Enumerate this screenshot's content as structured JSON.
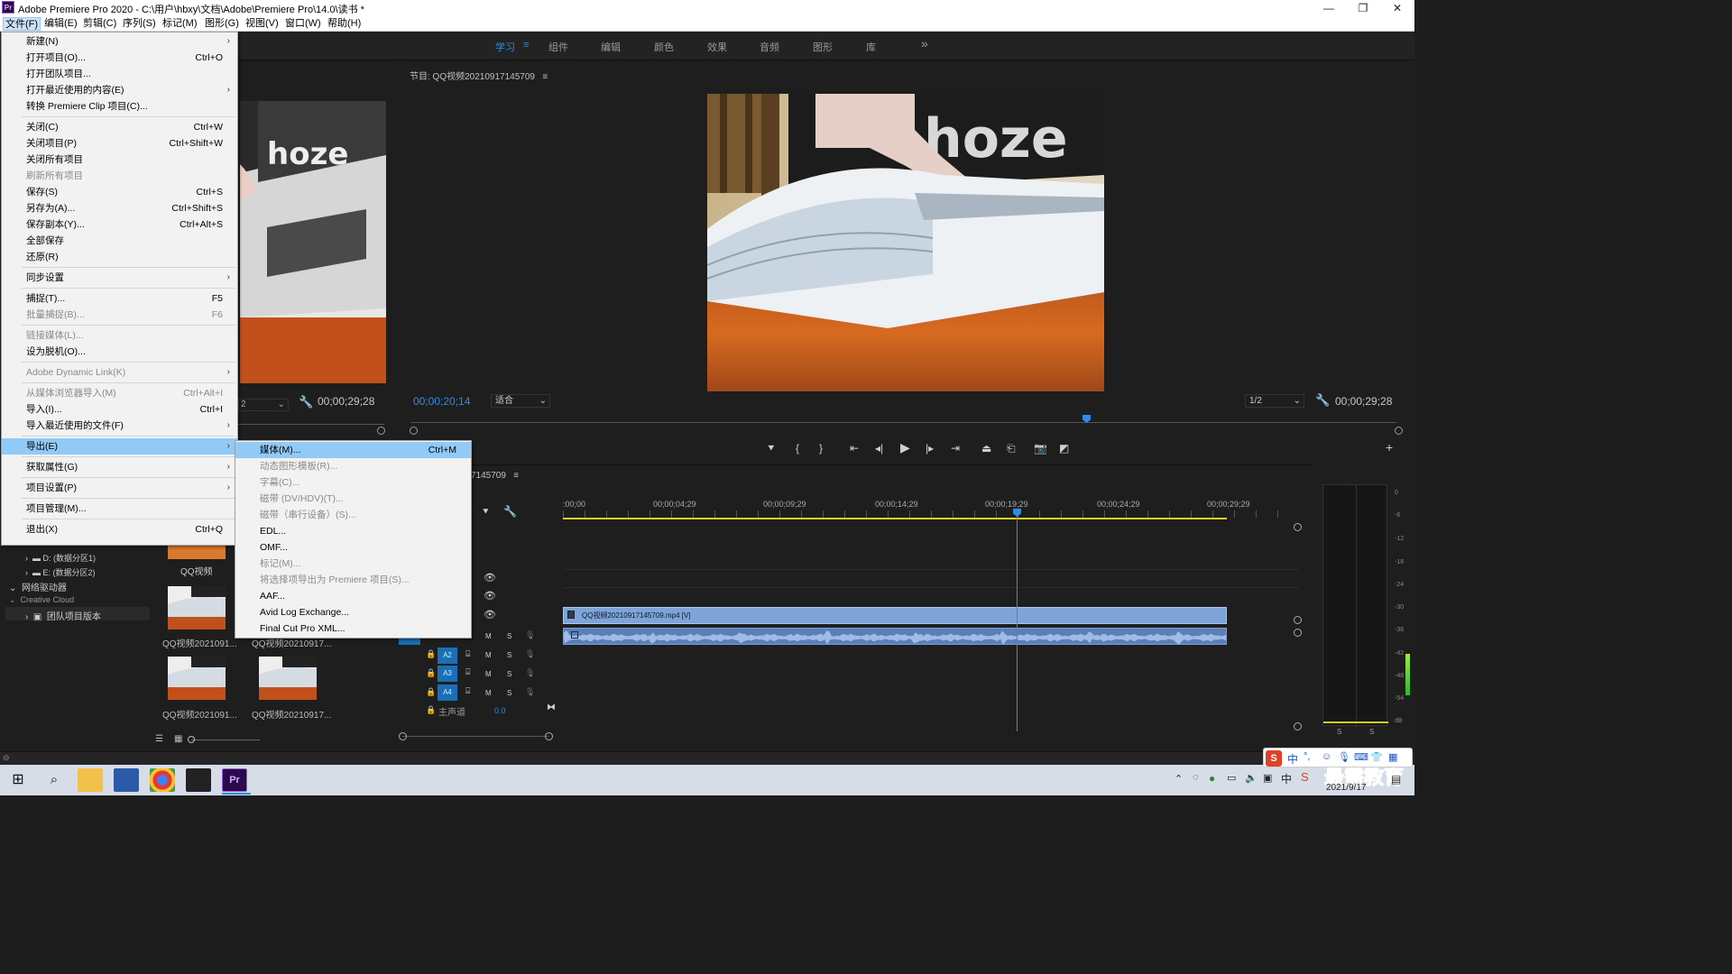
{
  "window": {
    "title": "Adobe Premiere Pro 2020 - C:\\用户\\hbxy\\文档\\Adobe\\Premiere Pro\\14.0\\读书 *",
    "logo_text": "Pr",
    "minimize_icon": "—",
    "maximize_icon": "❐",
    "close_icon": "✕"
  },
  "menubar": [
    {
      "label": "文件(F)"
    },
    {
      "label": "编辑(E)"
    },
    {
      "label": "剪辑(C)"
    },
    {
      "label": "序列(S)"
    },
    {
      "label": "标记(M)"
    },
    {
      "label": "图形(G)"
    },
    {
      "label": "视图(V)"
    },
    {
      "label": "窗口(W)"
    },
    {
      "label": "帮助(H)"
    }
  ],
  "workspaces": [
    {
      "label": "学习"
    },
    {
      "label": "≡"
    },
    {
      "label": "组件"
    },
    {
      "label": "编辑"
    },
    {
      "label": "颜色"
    },
    {
      "label": "效果"
    },
    {
      "label": "音频"
    },
    {
      "label": "图形"
    },
    {
      "label": "库"
    },
    {
      "label": "»"
    }
  ],
  "file_menu": [
    {
      "label": "新建(N)",
      "shortcut": "",
      "submenu": true,
      "disabled": false
    },
    {
      "label": "打开项目(O)...",
      "shortcut": "Ctrl+O",
      "submenu": false,
      "disabled": false
    },
    {
      "label": "打开团队项目...",
      "shortcut": "",
      "submenu": false,
      "disabled": false
    },
    {
      "label": "打开最近使用的内容(E)",
      "shortcut": "",
      "submenu": true,
      "disabled": false
    },
    {
      "label": "转换 Premiere Clip 项目(C)...",
      "shortcut": "",
      "submenu": false,
      "disabled": false
    },
    {
      "label": "关闭(C)",
      "shortcut": "Ctrl+W",
      "submenu": false,
      "disabled": false
    },
    {
      "label": "关闭项目(P)",
      "shortcut": "Ctrl+Shift+W",
      "submenu": false,
      "disabled": false
    },
    {
      "label": "关闭所有项目",
      "shortcut": "",
      "submenu": false,
      "disabled": false
    },
    {
      "label": "刷新所有项目",
      "shortcut": "",
      "submenu": false,
      "disabled": true
    },
    {
      "label": "保存(S)",
      "shortcut": "Ctrl+S",
      "submenu": false,
      "disabled": false
    },
    {
      "label": "另存为(A)...",
      "shortcut": "Ctrl+Shift+S",
      "submenu": false,
      "disabled": false
    },
    {
      "label": "保存副本(Y)...",
      "shortcut": "Ctrl+Alt+S",
      "submenu": false,
      "disabled": false
    },
    {
      "label": "全部保存",
      "shortcut": "",
      "submenu": false,
      "disabled": false
    },
    {
      "label": "还原(R)",
      "shortcut": "",
      "submenu": false,
      "disabled": false
    },
    {
      "label": "同步设置",
      "shortcut": "",
      "submenu": true,
      "disabled": false
    },
    {
      "label": "捕捉(T)...",
      "shortcut": "F5",
      "submenu": false,
      "disabled": false
    },
    {
      "label": "批量捕捉(B)...",
      "shortcut": "F6",
      "submenu": false,
      "disabled": true
    },
    {
      "label": "链接媒体(L)...",
      "shortcut": "",
      "submenu": false,
      "disabled": true
    },
    {
      "label": "设为脱机(O)...",
      "shortcut": "",
      "submenu": false,
      "disabled": false
    },
    {
      "label": "Adobe Dynamic Link(K)",
      "shortcut": "",
      "submenu": true,
      "disabled": true
    },
    {
      "label": "从媒体浏览器导入(M)",
      "shortcut": "Ctrl+Alt+I",
      "submenu": false,
      "disabled": true
    },
    {
      "label": "导入(I)...",
      "shortcut": "Ctrl+I",
      "submenu": false,
      "disabled": false
    },
    {
      "label": "导入最近使用的文件(F)",
      "shortcut": "",
      "submenu": true,
      "disabled": false
    },
    {
      "label": "导出(E)",
      "shortcut": "",
      "submenu": true,
      "disabled": false,
      "highlighted": true
    },
    {
      "label": "获取属性(G)",
      "shortcut": "",
      "submenu": true,
      "disabled": false
    },
    {
      "label": "项目设置(P)",
      "shortcut": "",
      "submenu": true,
      "disabled": false
    },
    {
      "label": "项目管理(M)...",
      "shortcut": "",
      "submenu": false,
      "disabled": false
    },
    {
      "label": "退出(X)",
      "shortcut": "Ctrl+Q",
      "submenu": false,
      "disabled": false
    }
  ],
  "export_submenu": [
    {
      "label": "媒体(M)...",
      "shortcut": "Ctrl+M",
      "disabled": false,
      "highlighted": true
    },
    {
      "label": "动态图形模板(R)...",
      "shortcut": "",
      "disabled": true
    },
    {
      "label": "字幕(C)...",
      "shortcut": "",
      "disabled": true
    },
    {
      "label": "磁带 (DV/HDV)(T)...",
      "shortcut": "",
      "disabled": true
    },
    {
      "label": "磁带（串行设备）(S)...",
      "shortcut": "",
      "disabled": true
    },
    {
      "label": "EDL...",
      "shortcut": "",
      "disabled": false
    },
    {
      "label": "OMF...",
      "shortcut": "",
      "disabled": false
    },
    {
      "label": "标记(M)...",
      "shortcut": "",
      "disabled": true
    },
    {
      "label": "将选择项导出为 Premiere 项目(S)...",
      "shortcut": "",
      "disabled": true
    },
    {
      "label": "AAF...",
      "shortcut": "",
      "disabled": false
    },
    {
      "label": "Avid Log Exchange...",
      "shortcut": "",
      "disabled": false
    },
    {
      "label": "Final Cut Pro XML...",
      "shortcut": "",
      "disabled": false
    }
  ],
  "program_monitor": {
    "title": "节目: QQ视频20210917145709",
    "menu_icon": "≡",
    "current_timecode": "00;00;20;14",
    "fit_label": "适合",
    "resolution": "1/2",
    "duration": "00;00;29;28"
  },
  "source_monitor": {
    "duration": "00;00;29;28",
    "fraction_fragment": "2"
  },
  "timeline": {
    "sequence_fragment": "7145709",
    "menu_icon": "≡",
    "ruler_labels": [
      ":00;00",
      "00;00;04;29",
      "00;00;09;29",
      "00;00;14;29",
      "00;00;19;29",
      "00;00;24;29",
      "00;00;29;29"
    ],
    "playhead_fraction": 0.684,
    "video_clip": "QQ视频20210917145709.mp4 [V]",
    "audio_tracks": [
      {
        "name": "A2",
        "m": "M",
        "s": "S"
      },
      {
        "name": "A3",
        "m": "M",
        "s": "S"
      },
      {
        "name": "A4",
        "m": "M",
        "s": "S"
      }
    ],
    "a1_m": "M",
    "a1_s": "S",
    "master_label": "主声道",
    "master_value": "0.0"
  },
  "meters": {
    "db_labels": [
      "0",
      "-6",
      "-12",
      "-18",
      "-24",
      "-30",
      "-36",
      "-42",
      "-48",
      "-54",
      "dB"
    ],
    "solo_labels": [
      "S",
      "S"
    ]
  },
  "project_panel": {
    "tree": [
      {
        "label": "D: (数据分区1)"
      },
      {
        "label": "E: (数据分区2)"
      },
      {
        "label": "网络驱动器"
      },
      {
        "label": "Creative Cloud"
      },
      {
        "label": "团队项目版本"
      }
    ],
    "thumbs": [
      {
        "label": "QQ视频"
      },
      {
        "label": "QQ视频2021091..."
      },
      {
        "label": "QQ视频20210917..."
      },
      {
        "label": "QQ视频2021091..."
      },
      {
        "label": "QQ视频20210917..."
      }
    ]
  },
  "taskbar": {
    "date": "2021/9/17",
    "ime_lang": "中",
    "watermark": "最需教育"
  },
  "colors": {
    "accent_blue": "#2d8ceb",
    "clip_video": "#7da3d8",
    "clip_audio": "#5b7fb8",
    "menu_highlight": "#91c9f7",
    "timeline_yellow": "#e3d21f"
  }
}
